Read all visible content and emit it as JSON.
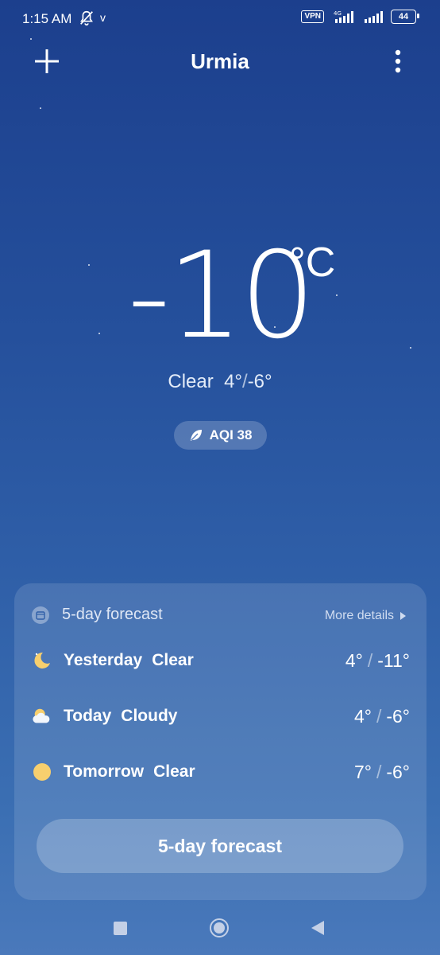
{
  "status_bar": {
    "time": "1:15 AM",
    "extra": "v",
    "vpn_label": "VPN",
    "network": "4G",
    "battery": "44"
  },
  "header": {
    "city": "Urmia",
    "add_icon": "plus-icon",
    "menu_icon": "more-vertical-icon"
  },
  "current": {
    "temperature": "-10",
    "unit": "°C",
    "condition": "Clear",
    "high": "4°",
    "low": "-6°",
    "aqi_label": "AQI 38"
  },
  "forecast": {
    "title": "5-day forecast",
    "more_label": "More details",
    "rows": [
      {
        "day": "Yesterday",
        "condition": "Clear",
        "high": "4°",
        "low": "-11°",
        "icon": "moon-icon"
      },
      {
        "day": "Today",
        "condition": "Cloudy",
        "high": "4°",
        "low": "-6°",
        "icon": "cloudy-icon"
      },
      {
        "day": "Tomorrow",
        "condition": "Clear",
        "high": "7°",
        "low": "-6°",
        "icon": "sun-icon"
      }
    ],
    "button_label": "5-day forecast"
  },
  "colors": {
    "bg_top": "#1c3f8d",
    "bg_bottom": "#4a79bb",
    "sun": "#f7cf6e"
  }
}
